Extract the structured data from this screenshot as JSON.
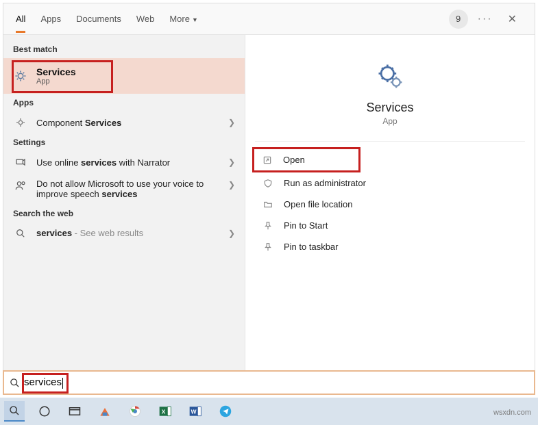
{
  "header": {
    "tabs": [
      "All",
      "Apps",
      "Documents",
      "Web",
      "More"
    ],
    "badge": "9"
  },
  "left": {
    "best_match_label": "Best match",
    "best_match": {
      "title": "Services",
      "sub": "App"
    },
    "apps_label": "Apps",
    "apps_item": {
      "prefix": "Component ",
      "bold": "Services"
    },
    "settings_label": "Settings",
    "settings_items": [
      {
        "prefix": "Use online ",
        "bold": "services",
        "suffix": " with Narrator"
      },
      {
        "prefix": "Do not allow Microsoft to use your voice to improve speech ",
        "bold": "services",
        "suffix": ""
      }
    ],
    "web_label": "Search the web",
    "web_item": {
      "bold": "services",
      "suffix": " - See web results"
    }
  },
  "right": {
    "title": "Services",
    "sub": "App",
    "actions": [
      "Open",
      "Run as administrator",
      "Open file location",
      "Pin to Start",
      "Pin to taskbar"
    ]
  },
  "search": {
    "value": "services"
  },
  "watermark": "wsxdn.com"
}
